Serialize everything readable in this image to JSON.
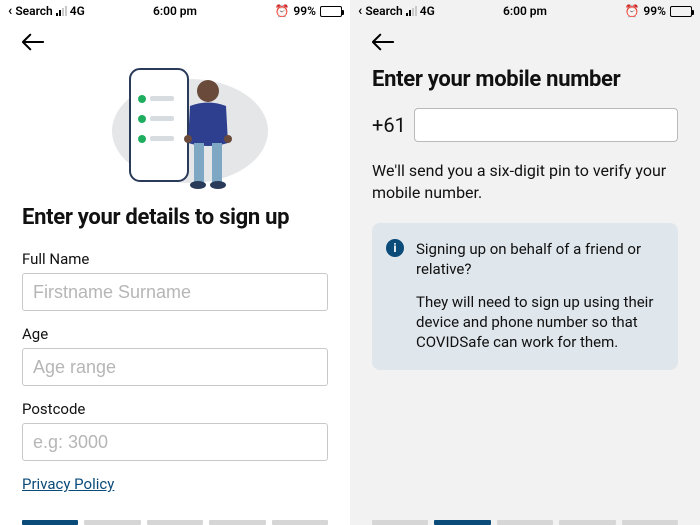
{
  "status": {
    "search": "Search",
    "network": "4G",
    "time": "6:00 pm",
    "battery": "99%"
  },
  "left": {
    "title": "Enter your details to sign up",
    "fullname_label": "Full Name",
    "fullname_placeholder": "Firstname Surname",
    "age_label": "Age",
    "age_placeholder": "Age range",
    "postcode_label": "Postcode",
    "postcode_placeholder": "e.g: 3000",
    "privacy": "Privacy Policy",
    "active_step": 1,
    "total_steps": 5
  },
  "right": {
    "title": "Enter your mobile number",
    "prefix": "+61",
    "subtext": "We'll send you a six-digit pin to verify your mobile number.",
    "info_q": "Signing up on behalf of a friend or relative?",
    "info_body": "They will need to sign up using their device and phone number so that COVIDSafe can work for them.",
    "active_step": 2,
    "total_steps": 5
  }
}
